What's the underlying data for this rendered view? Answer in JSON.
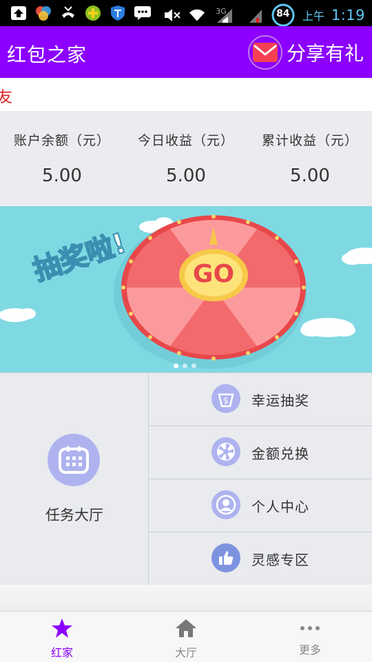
{
  "status_bar": {
    "ampm": "上午",
    "time": "1:19",
    "battery": "84",
    "network": "3G"
  },
  "header": {
    "title": "红包之家",
    "share_label": "分享有礼"
  },
  "marquee": {
    "text": "友"
  },
  "stats": [
    {
      "label": "账户余额（元）",
      "value": "5.00"
    },
    {
      "label": "今日收益（元）",
      "value": "5.00"
    },
    {
      "label": "累计收益（元）",
      "value": "5.00"
    }
  ],
  "banner": {
    "headline": "抽奖啦!",
    "button": "GO",
    "slide_count": 3,
    "active_slide": 1
  },
  "grid": {
    "task_hall": {
      "label": "任务大厅",
      "icon": "calendar-icon"
    },
    "items": [
      {
        "label": "幸运抽奖",
        "icon": "coin-bag-icon"
      },
      {
        "label": "金额兑换",
        "icon": "shutter-icon"
      },
      {
        "label": "个人中心",
        "icon": "user-icon"
      },
      {
        "label": "灵感专区",
        "icon": "thumbs-up-icon"
      }
    ]
  },
  "bottom_nav": [
    {
      "label": "红家",
      "icon": "star-icon",
      "active": true
    },
    {
      "label": "大厅",
      "icon": "home-icon",
      "active": false
    },
    {
      "label": "更多",
      "icon": "more-icon",
      "active": false
    }
  ],
  "colors": {
    "brand": "#8b00ff",
    "accent_icon": "#aeb3ef",
    "marquee_text": "#e02020",
    "banner_bg": "#7fd9e3"
  }
}
